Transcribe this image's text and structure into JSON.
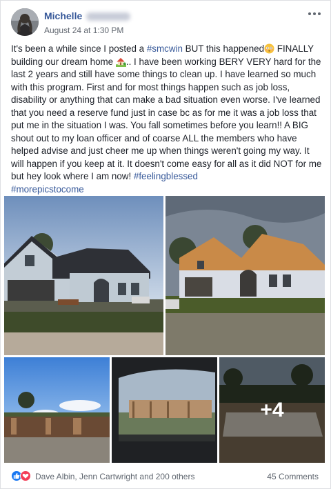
{
  "post": {
    "author_first": "Michelle",
    "timestamp": "August 24 at 1:30 PM",
    "text": {
      "p1": "It's been a while since I posted a ",
      "tag1": "#smcwin",
      "p2": " BUT this happened",
      "p3": " FINALLY building our dream home ",
      "p4": ".. I have been working BERY VERY hard for the last 2 years and still have some things to clean up. I have learned so much with this program. First and for most things happen such as job loss, disability or anything that can make a bad situation even worse. I've learned that you need a reserve fund just in case bc as for me it was a job loss that put me in the situation I was. You fall sometimes before you learn!! A BIG shout out to my loan officer and of coarse ALL the members who have helped advise and just cheer me up when things weren't going my way. It will happen if you keep at it. It doesn't come easy for all as it did NOT for me but hey look where I am now! ",
      "tag2": "#feelingblessed",
      "tag3": "#morepicstocome"
    },
    "more_photos_count": "+4"
  },
  "footer": {
    "reactors": "Dave Albin, Jenn Cartwright and 200 others",
    "comments": "45 Comments"
  },
  "icons": {
    "more": "more-options-icon",
    "like": "like-reaction-icon",
    "love": "love-reaction-icon",
    "flushed_emoji": "flushed-face-emoji",
    "house_emoji": "house-with-garden-emoji"
  },
  "colors": {
    "link": "#365899",
    "like": "#1877f2",
    "love": "#f33e58"
  }
}
